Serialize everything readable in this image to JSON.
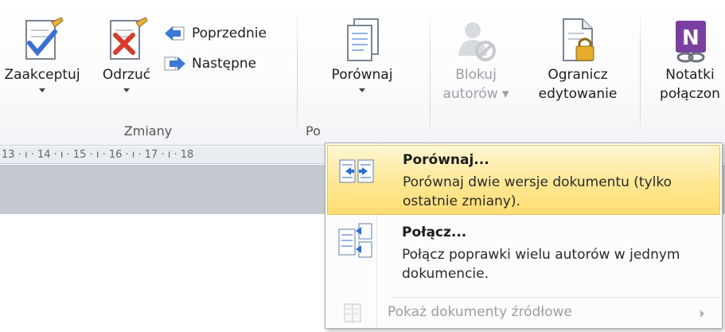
{
  "ribbon": {
    "accept_label": "Zaakceptuj",
    "reject_label": "Odrzuć",
    "previous_label": "Poprzednie",
    "next_label": "Następne",
    "changes_group_label": "Zmiany",
    "compare_label": "Porównaj",
    "compare_group_label_cut": "Po",
    "block_authors_line1": "Blokuj",
    "block_authors_line2": "autorów",
    "restrict_line1": "Ogranicz",
    "restrict_line2": "edytowanie",
    "notes_line1": "Notatki",
    "notes_line2": "połączon"
  },
  "ruler": {
    "text": "13 · ı · 14 · ı · 15 · ı · 16 · ı · 17 · ı · 18"
  },
  "menu": {
    "items": [
      {
        "title": "Porównaj...",
        "description": "Porównaj dwie wersje dokumentu (tylko ostatnie zmiany).",
        "icon": "compare-icon"
      },
      {
        "title": "Połącz...",
        "description": "Połącz poprawki wielu autorów w jednym dokumencie.",
        "icon": "combine-icon"
      }
    ],
    "show_sources_label": "Pokaż dokumenty źródłowe"
  },
  "colors": {
    "highlight": "#ffe793",
    "ribbon_bg": "#f1f3f6",
    "gray_band": "#c5c9cf",
    "disabled_text": "#9aa0a6"
  }
}
